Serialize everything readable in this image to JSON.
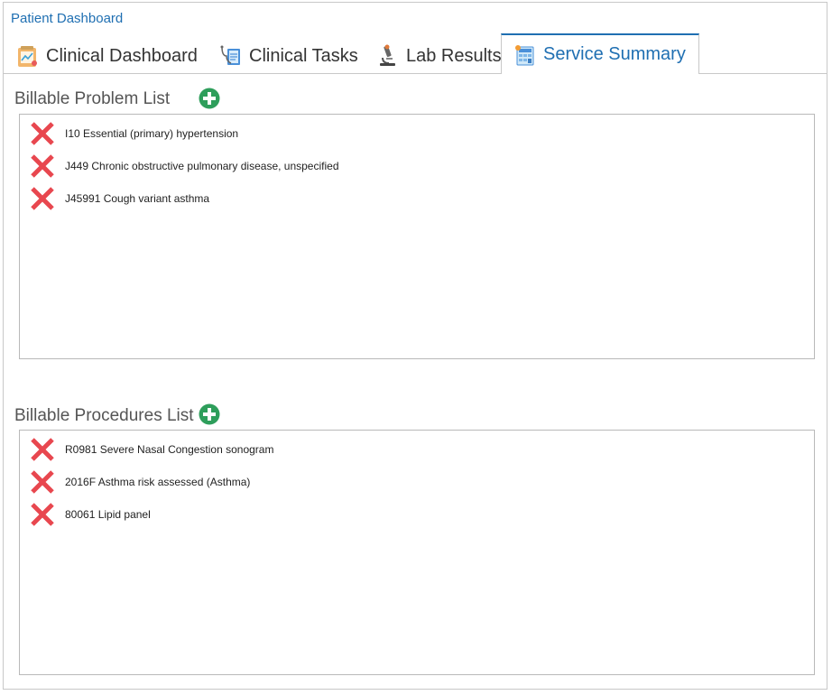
{
  "app": {
    "title": "Patient Dashboard"
  },
  "tabs": [
    {
      "label": "Clinical Dashboard",
      "icon": "clipboard-chart-icon",
      "active": false
    },
    {
      "label": "Clinical Tasks",
      "icon": "stethoscope-tasks-icon",
      "active": false
    },
    {
      "label": "Lab Results",
      "icon": "microscope-icon",
      "active": false
    },
    {
      "label": "Service Summary",
      "icon": "calculator-summary-icon",
      "active": true
    }
  ],
  "problems": {
    "title": "Billable Problem List",
    "add_icon": "plus-circle-icon",
    "items": [
      {
        "text": "I10 Essential (primary) hypertension"
      },
      {
        "text": "J449 Chronic obstructive pulmonary disease, unspecified"
      },
      {
        "text": "J45991 Cough variant asthma"
      }
    ]
  },
  "procedures": {
    "title": "Billable Procedures List",
    "add_icon": "plus-circle-icon",
    "items": [
      {
        "text": "R0981 Severe Nasal Congestion sonogram"
      },
      {
        "text": "2016F Asthma risk assessed (Asthma)"
      },
      {
        "text": "80061 Lipid panel"
      }
    ]
  },
  "colors": {
    "accent": "#1f6fb2",
    "add_green": "#2e9e5b",
    "delete_red": "#e8474f",
    "border": "#c8c8c8"
  }
}
